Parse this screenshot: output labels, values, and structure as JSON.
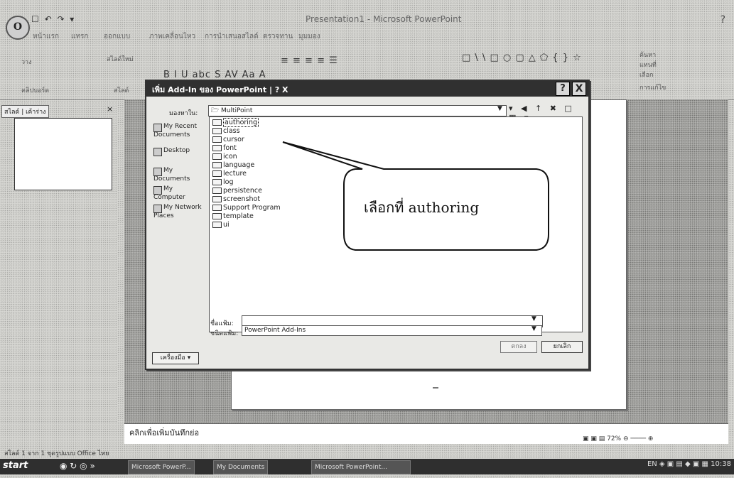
{
  "window": {
    "title": "Presentation1 - Microsoft PowerPoint",
    "qat": "☐ ↶ ↷ ▾",
    "help_icon": "?"
  },
  "ribbon": {
    "tabs": [
      "หน้าแรก",
      "แทรก",
      "ออกแบบ",
      "ภาพเคลื่อนไหว",
      "การนำเสนอสไลด์",
      "ตรวจทาน",
      "มุมมอง"
    ],
    "groups": {
      "clipboard": [
        "วาง",
        "คลิปบอร์ด"
      ],
      "slides": [
        "สไลด์ใหม่",
        "สไลด์"
      ],
      "font_symbols": "B I U abc S AV Aa A",
      "paragraph_symbols": "≡ ≡ ≡ ≡ ☰",
      "drawing_symbols": "□ \\ \\ □ ○ ▢ △ ⬠ { } ☆",
      "right": [
        "ค้นหา",
        "แทนที่",
        "เลือก",
        "การแก้ไข"
      ]
    }
  },
  "slides_pane": {
    "tab_label": "สไลด์ | เค้าร่าง",
    "close": "×"
  },
  "notes": {
    "placeholder": "คลิกเพื่อเพิ่มบันทึกย่อ"
  },
  "status": {
    "left": "สไลด์ 1 จาก 1   ชุดรูปแบบ Office   ไทย",
    "zoom": "▣ ▣ ▤  72%  ⊖ ──── ⊕"
  },
  "taskbar": {
    "start": "start",
    "quick_launch": "◉ ↻ ◎ »",
    "buttons": [
      "Microsoft PowerP...",
      "My Documents",
      "Microsoft PowerPoint..."
    ],
    "tray": "EN ◈ ▣ ▤ ◆ ▣ ▦ 10:38"
  },
  "dialog": {
    "title": "เพิ่ม Add-In ของ PowerPoint | ? X",
    "help": "?",
    "close": "X",
    "look_in_label": "มองหาใน:",
    "look_in_value": "MultiPoint",
    "toolbar_icons": "▾ ◀ ↑ ✖ □ ▦ ▾",
    "places": [
      "My Recent Documents",
      "Desktop",
      "My Documents",
      "My Computer",
      "My Network Places"
    ],
    "files": [
      "authoring",
      "class",
      "cursor",
      "font",
      "icon",
      "language",
      "lecture",
      "log",
      "persistence",
      "screenshot",
      "Support Program",
      "template",
      "ui"
    ],
    "filename_label": "ชื่อแฟ้ม:",
    "filename_value": "",
    "filetype_label": "ชนิดแฟ้ม:",
    "filetype_value": "PowerPoint Add-Ins",
    "tools": "เครื่องมือ ▾",
    "ok": "ตกลง",
    "cancel": "ยกเลิก"
  },
  "callout": {
    "text": "เลือกที่ authoring"
  }
}
